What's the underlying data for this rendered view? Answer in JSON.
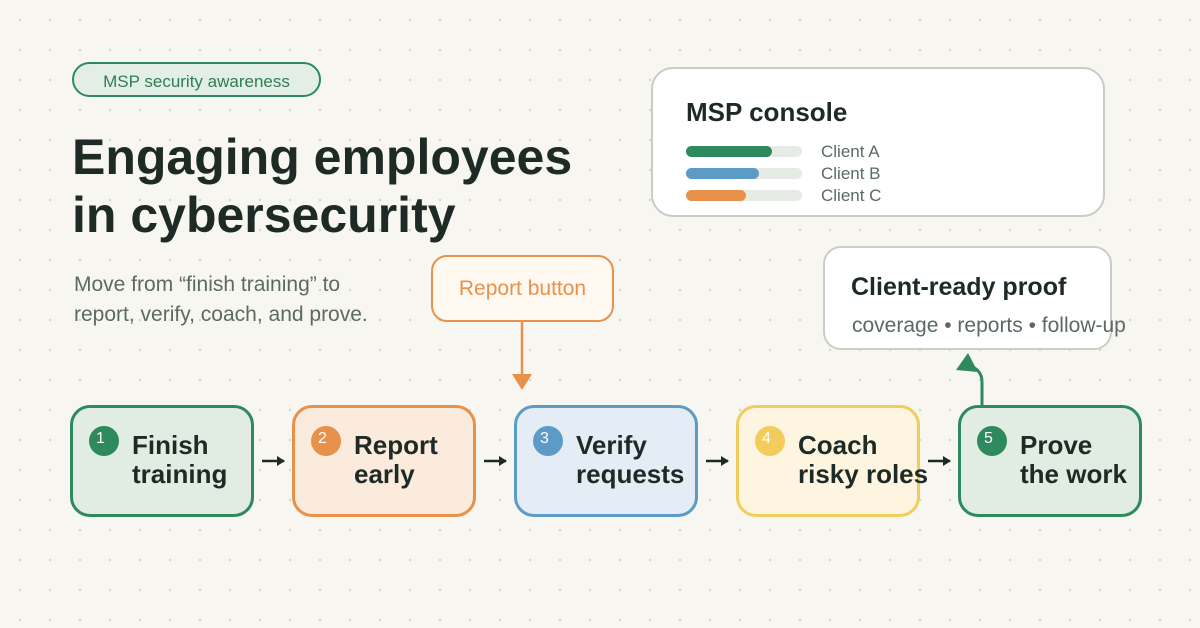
{
  "badge": "MSP security awareness",
  "title": {
    "line1": "Engaging employees",
    "line2": "in cybersecurity"
  },
  "subtitle": {
    "line1": "Move from “finish training” to",
    "line2": "report, verify, coach, and prove."
  },
  "console": {
    "title": "MSP console",
    "clients": [
      {
        "label": "Client A",
        "progress": 0.74,
        "color": "#2e8a5c"
      },
      {
        "label": "Client B",
        "progress": 0.63,
        "color": "#5b9bc5"
      },
      {
        "label": "Client C",
        "progress": 0.52,
        "color": "#e8914a"
      }
    ]
  },
  "proof": {
    "title": "Client-ready proof",
    "subtitle": "coverage • reports • follow-up"
  },
  "report_callout": "Report button",
  "steps": [
    {
      "number": "1",
      "line1": "Finish",
      "line2": "training",
      "border": "#2e8a5c",
      "fill": "#e1ede3",
      "dot": "#2e8a5c"
    },
    {
      "number": "2",
      "line1": "Report",
      "line2": "early",
      "border": "#e8914a",
      "fill": "#fbebdd",
      "dot": "#e8914a"
    },
    {
      "number": "3",
      "line1": "Verify",
      "line2": "requests",
      "border": "#5b9bc5",
      "fill": "#e4edf5",
      "dot": "#5b9bc5"
    },
    {
      "number": "4",
      "line1": "Coach",
      "line2": "risky roles",
      "border": "#f2cd5c",
      "fill": "#fdf5e0",
      "dot": "#f2cd5c"
    },
    {
      "number": "5",
      "line1": "Prove",
      "line2": "the work",
      "border": "#2e8a5c",
      "fill": "#e1ede3",
      "dot": "#2e8a5c"
    }
  ]
}
